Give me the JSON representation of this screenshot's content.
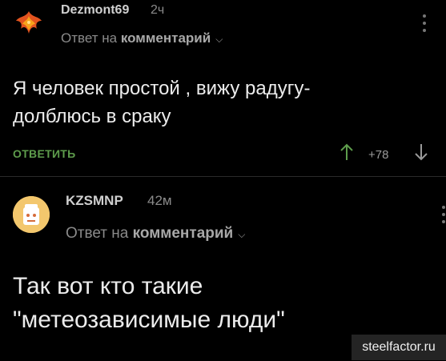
{
  "comments": [
    {
      "username": "Dezmont69",
      "time": "2ч",
      "reply_prefix": "Ответ на",
      "reply_target": "комментарий",
      "text_lines": [
        "Я человек простой , вижу радугу-",
        "долблюсь в сраку"
      ],
      "reply_button": "ОТВЕТИТЬ",
      "rating": "+78",
      "avatar_icon": "phoenix-avatar-icon"
    },
    {
      "username": "KZSMNP",
      "time": "42м",
      "reply_prefix": "Ответ на",
      "reply_target": "комментарий",
      "text_lines": [
        "Так вот кто такие",
        "\"метеозависимые люди\""
      ],
      "avatar_icon": "cartoon-avatar-icon"
    }
  ],
  "watermark": "steelfactor.ru",
  "colors": {
    "background": "#000000",
    "accent_green": "#5e9d4c",
    "muted_text": "#8a8a8a"
  }
}
